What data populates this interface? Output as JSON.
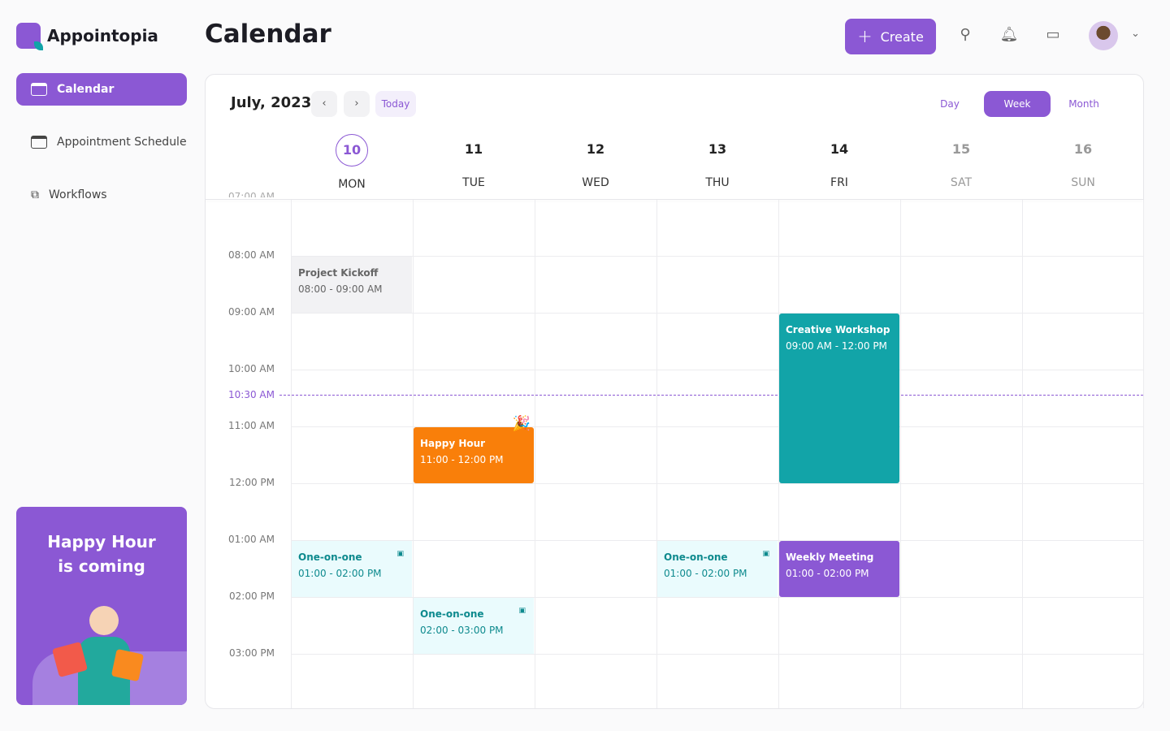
{
  "app": {
    "name": "Appointopia",
    "page_title": "Calendar"
  },
  "sidebar": {
    "items": [
      {
        "label": "Calendar",
        "active": true
      },
      {
        "label": "Appointment Schedule"
      },
      {
        "label": "Workflows"
      }
    ]
  },
  "promo": {
    "line1": "Happy Hour",
    "line2": "is coming"
  },
  "header": {
    "create_label": "Create",
    "icons": [
      "search-icon",
      "bell-icon",
      "message-icon",
      "avatar",
      "chevron-down-icon"
    ]
  },
  "calendar": {
    "month": "July, 2023",
    "today_label": "Today",
    "views": [
      {
        "label": "Day"
      },
      {
        "label": "Week",
        "active": true
      },
      {
        "label": "Month"
      }
    ],
    "days": [
      {
        "num": "10",
        "name": "MON",
        "current": true
      },
      {
        "num": "11",
        "name": "TUE"
      },
      {
        "num": "12",
        "name": "WED"
      },
      {
        "num": "13",
        "name": "THU"
      },
      {
        "num": "14",
        "name": "FRI"
      },
      {
        "num": "15",
        "name": "SAT",
        "weekend": true
      },
      {
        "num": "16",
        "name": "SUN",
        "weekend": true
      }
    ],
    "times": [
      "07:00 AM",
      "08:00 AM",
      "09:00 AM",
      "10:00 AM",
      "11:00 AM",
      "12:00 PM",
      "01:00 AM",
      "02:00 PM",
      "03:00 PM"
    ],
    "now_label": "10:30 AM",
    "events": [
      {
        "title": "Project Kickoff",
        "time": "08:00 - 09:00 AM",
        "day": 0,
        "start": 8,
        "end": 9,
        "color": "#f2f2f4",
        "text": "#666"
      },
      {
        "title": "Creative Workshop",
        "time": "09:00 AM - 12:00 PM",
        "day": 4,
        "start": 9,
        "end": 12,
        "color": "#12a4a8",
        "text": "#fff"
      },
      {
        "title": "Happy Hour",
        "time": "11:00 - 12:00 PM",
        "day": 1,
        "start": 11,
        "end": 12,
        "color": "#f97f0a",
        "text": "#fff"
      },
      {
        "title": "One-on-one",
        "time": "01:00 - 02:00 PM",
        "day": 0,
        "start": 13,
        "end": 14,
        "color": "#eafbfd",
        "text": "#0e8a8e"
      },
      {
        "title": "One-on-one",
        "time": "01:00 - 02:00 PM",
        "day": 3,
        "start": 13,
        "end": 14,
        "color": "#eafbfd",
        "text": "#0e8a8e"
      },
      {
        "title": "Weekly Meeting",
        "time": "01:00 - 02:00 PM",
        "day": 4,
        "start": 13,
        "end": 14,
        "color": "#8b58d4",
        "text": "#fff"
      },
      {
        "title": "One-on-one",
        "time": "02:00 - 03:00 PM",
        "day": 1,
        "start": 14,
        "end": 15,
        "color": "#eafbfd",
        "text": "#0e8a8e"
      }
    ]
  },
  "colors": {
    "accent": "#8b58d4",
    "teal": "#12a4a8",
    "orange": "#f97f0a"
  }
}
